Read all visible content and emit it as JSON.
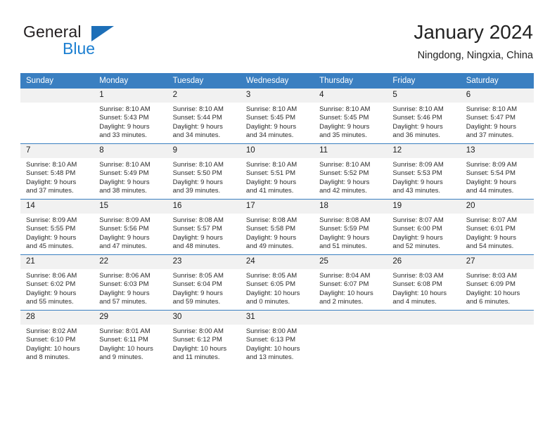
{
  "brand": {
    "line1": "General",
    "line2": "Blue",
    "triangle_icon": "triangle-icon",
    "colors": {
      "dark": "#231f20",
      "blue": "#1c7fd1",
      "triangle": "#1d6fb8"
    }
  },
  "header": {
    "title": "January 2024",
    "location": "Ningdong, Ningxia, China"
  },
  "theme": {
    "header_bg": "#3a7fc1",
    "daynum_bg": "#f1f1f1",
    "text": "#1b1b1b"
  },
  "calendar": {
    "weekdays": [
      "Sunday",
      "Monday",
      "Tuesday",
      "Wednesday",
      "Thursday",
      "Friday",
      "Saturday"
    ],
    "weeks": [
      [
        {
          "day": "",
          "sunrise": "",
          "sunset": "",
          "daylight1": "",
          "daylight2": ""
        },
        {
          "day": "1",
          "sunrise": "Sunrise: 8:10 AM",
          "sunset": "Sunset: 5:43 PM",
          "daylight1": "Daylight: 9 hours",
          "daylight2": "and 33 minutes."
        },
        {
          "day": "2",
          "sunrise": "Sunrise: 8:10 AM",
          "sunset": "Sunset: 5:44 PM",
          "daylight1": "Daylight: 9 hours",
          "daylight2": "and 34 minutes."
        },
        {
          "day": "3",
          "sunrise": "Sunrise: 8:10 AM",
          "sunset": "Sunset: 5:45 PM",
          "daylight1": "Daylight: 9 hours",
          "daylight2": "and 34 minutes."
        },
        {
          "day": "4",
          "sunrise": "Sunrise: 8:10 AM",
          "sunset": "Sunset: 5:45 PM",
          "daylight1": "Daylight: 9 hours",
          "daylight2": "and 35 minutes."
        },
        {
          "day": "5",
          "sunrise": "Sunrise: 8:10 AM",
          "sunset": "Sunset: 5:46 PM",
          "daylight1": "Daylight: 9 hours",
          "daylight2": "and 36 minutes."
        },
        {
          "day": "6",
          "sunrise": "Sunrise: 8:10 AM",
          "sunset": "Sunset: 5:47 PM",
          "daylight1": "Daylight: 9 hours",
          "daylight2": "and 37 minutes."
        }
      ],
      [
        {
          "day": "7",
          "sunrise": "Sunrise: 8:10 AM",
          "sunset": "Sunset: 5:48 PM",
          "daylight1": "Daylight: 9 hours",
          "daylight2": "and 37 minutes."
        },
        {
          "day": "8",
          "sunrise": "Sunrise: 8:10 AM",
          "sunset": "Sunset: 5:49 PM",
          "daylight1": "Daylight: 9 hours",
          "daylight2": "and 38 minutes."
        },
        {
          "day": "9",
          "sunrise": "Sunrise: 8:10 AM",
          "sunset": "Sunset: 5:50 PM",
          "daylight1": "Daylight: 9 hours",
          "daylight2": "and 39 minutes."
        },
        {
          "day": "10",
          "sunrise": "Sunrise: 8:10 AM",
          "sunset": "Sunset: 5:51 PM",
          "daylight1": "Daylight: 9 hours",
          "daylight2": "and 41 minutes."
        },
        {
          "day": "11",
          "sunrise": "Sunrise: 8:10 AM",
          "sunset": "Sunset: 5:52 PM",
          "daylight1": "Daylight: 9 hours",
          "daylight2": "and 42 minutes."
        },
        {
          "day": "12",
          "sunrise": "Sunrise: 8:09 AM",
          "sunset": "Sunset: 5:53 PM",
          "daylight1": "Daylight: 9 hours",
          "daylight2": "and 43 minutes."
        },
        {
          "day": "13",
          "sunrise": "Sunrise: 8:09 AM",
          "sunset": "Sunset: 5:54 PM",
          "daylight1": "Daylight: 9 hours",
          "daylight2": "and 44 minutes."
        }
      ],
      [
        {
          "day": "14",
          "sunrise": "Sunrise: 8:09 AM",
          "sunset": "Sunset: 5:55 PM",
          "daylight1": "Daylight: 9 hours",
          "daylight2": "and 45 minutes."
        },
        {
          "day": "15",
          "sunrise": "Sunrise: 8:09 AM",
          "sunset": "Sunset: 5:56 PM",
          "daylight1": "Daylight: 9 hours",
          "daylight2": "and 47 minutes."
        },
        {
          "day": "16",
          "sunrise": "Sunrise: 8:08 AM",
          "sunset": "Sunset: 5:57 PM",
          "daylight1": "Daylight: 9 hours",
          "daylight2": "and 48 minutes."
        },
        {
          "day": "17",
          "sunrise": "Sunrise: 8:08 AM",
          "sunset": "Sunset: 5:58 PM",
          "daylight1": "Daylight: 9 hours",
          "daylight2": "and 49 minutes."
        },
        {
          "day": "18",
          "sunrise": "Sunrise: 8:08 AM",
          "sunset": "Sunset: 5:59 PM",
          "daylight1": "Daylight: 9 hours",
          "daylight2": "and 51 minutes."
        },
        {
          "day": "19",
          "sunrise": "Sunrise: 8:07 AM",
          "sunset": "Sunset: 6:00 PM",
          "daylight1": "Daylight: 9 hours",
          "daylight2": "and 52 minutes."
        },
        {
          "day": "20",
          "sunrise": "Sunrise: 8:07 AM",
          "sunset": "Sunset: 6:01 PM",
          "daylight1": "Daylight: 9 hours",
          "daylight2": "and 54 minutes."
        }
      ],
      [
        {
          "day": "21",
          "sunrise": "Sunrise: 8:06 AM",
          "sunset": "Sunset: 6:02 PM",
          "daylight1": "Daylight: 9 hours",
          "daylight2": "and 55 minutes."
        },
        {
          "day": "22",
          "sunrise": "Sunrise: 8:06 AM",
          "sunset": "Sunset: 6:03 PM",
          "daylight1": "Daylight: 9 hours",
          "daylight2": "and 57 minutes."
        },
        {
          "day": "23",
          "sunrise": "Sunrise: 8:05 AM",
          "sunset": "Sunset: 6:04 PM",
          "daylight1": "Daylight: 9 hours",
          "daylight2": "and 59 minutes."
        },
        {
          "day": "24",
          "sunrise": "Sunrise: 8:05 AM",
          "sunset": "Sunset: 6:05 PM",
          "daylight1": "Daylight: 10 hours",
          "daylight2": "and 0 minutes."
        },
        {
          "day": "25",
          "sunrise": "Sunrise: 8:04 AM",
          "sunset": "Sunset: 6:07 PM",
          "daylight1": "Daylight: 10 hours",
          "daylight2": "and 2 minutes."
        },
        {
          "day": "26",
          "sunrise": "Sunrise: 8:03 AM",
          "sunset": "Sunset: 6:08 PM",
          "daylight1": "Daylight: 10 hours",
          "daylight2": "and 4 minutes."
        },
        {
          "day": "27",
          "sunrise": "Sunrise: 8:03 AM",
          "sunset": "Sunset: 6:09 PM",
          "daylight1": "Daylight: 10 hours",
          "daylight2": "and 6 minutes."
        }
      ],
      [
        {
          "day": "28",
          "sunrise": "Sunrise: 8:02 AM",
          "sunset": "Sunset: 6:10 PM",
          "daylight1": "Daylight: 10 hours",
          "daylight2": "and 8 minutes."
        },
        {
          "day": "29",
          "sunrise": "Sunrise: 8:01 AM",
          "sunset": "Sunset: 6:11 PM",
          "daylight1": "Daylight: 10 hours",
          "daylight2": "and 9 minutes."
        },
        {
          "day": "30",
          "sunrise": "Sunrise: 8:00 AM",
          "sunset": "Sunset: 6:12 PM",
          "daylight1": "Daylight: 10 hours",
          "daylight2": "and 11 minutes."
        },
        {
          "day": "31",
          "sunrise": "Sunrise: 8:00 AM",
          "sunset": "Sunset: 6:13 PM",
          "daylight1": "Daylight: 10 hours",
          "daylight2": "and 13 minutes."
        },
        {
          "day": "",
          "sunrise": "",
          "sunset": "",
          "daylight1": "",
          "daylight2": ""
        },
        {
          "day": "",
          "sunrise": "",
          "sunset": "",
          "daylight1": "",
          "daylight2": ""
        },
        {
          "day": "",
          "sunrise": "",
          "sunset": "",
          "daylight1": "",
          "daylight2": ""
        }
      ]
    ]
  }
}
